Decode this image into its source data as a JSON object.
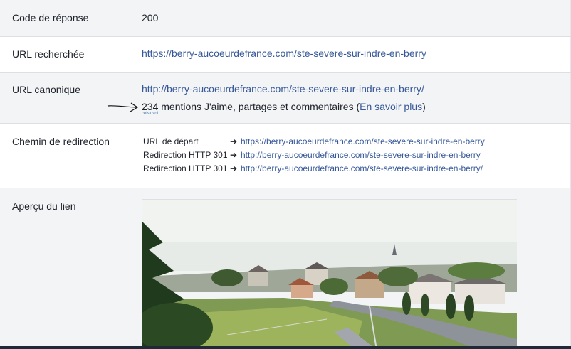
{
  "rows": {
    "response_code": {
      "label": "Code de réponse",
      "value": "200"
    },
    "searched_url": {
      "label": "URL recherchée",
      "value": "https://berry-aucoeurdefrance.com/ste-severe-sur-indre-en-berry"
    },
    "canonical_url": {
      "label": "URL canonique",
      "value": "http://berry-aucoeurdefrance.com/ste-severe-sur-indre-en-berry/",
      "engagement_count": "234",
      "engagement_text": " mentions J'aime, partages et commentaires (",
      "learn_more": "En savoir plus",
      "close_paren": ")",
      "tiny_note": "ceisiuvol"
    },
    "redirect_path": {
      "label": "Chemin de redirection",
      "items": [
        {
          "label": "URL de départ",
          "url": "https://berry-aucoeurdefrance.com/ste-severe-sur-indre-en-berry"
        },
        {
          "label": "Redirection HTTP 301",
          "url": "http://berry-aucoeurdefrance.com/ste-severe-sur-indre-en-berry"
        },
        {
          "label": "Redirection HTTP 301",
          "url": "http://berry-aucoeurdefrance.com/ste-severe-sur-indre-en-berry/"
        }
      ],
      "arrow": "➔"
    },
    "link_preview": {
      "label": "Aperçu du lien"
    }
  },
  "colors": {
    "link": "#365899",
    "row_gray": "#f3f4f6",
    "row_white": "#ffffff"
  },
  "icons": {
    "annotation": "hand-drawn-arrow-icon",
    "redirect": "arrow-right-icon"
  }
}
